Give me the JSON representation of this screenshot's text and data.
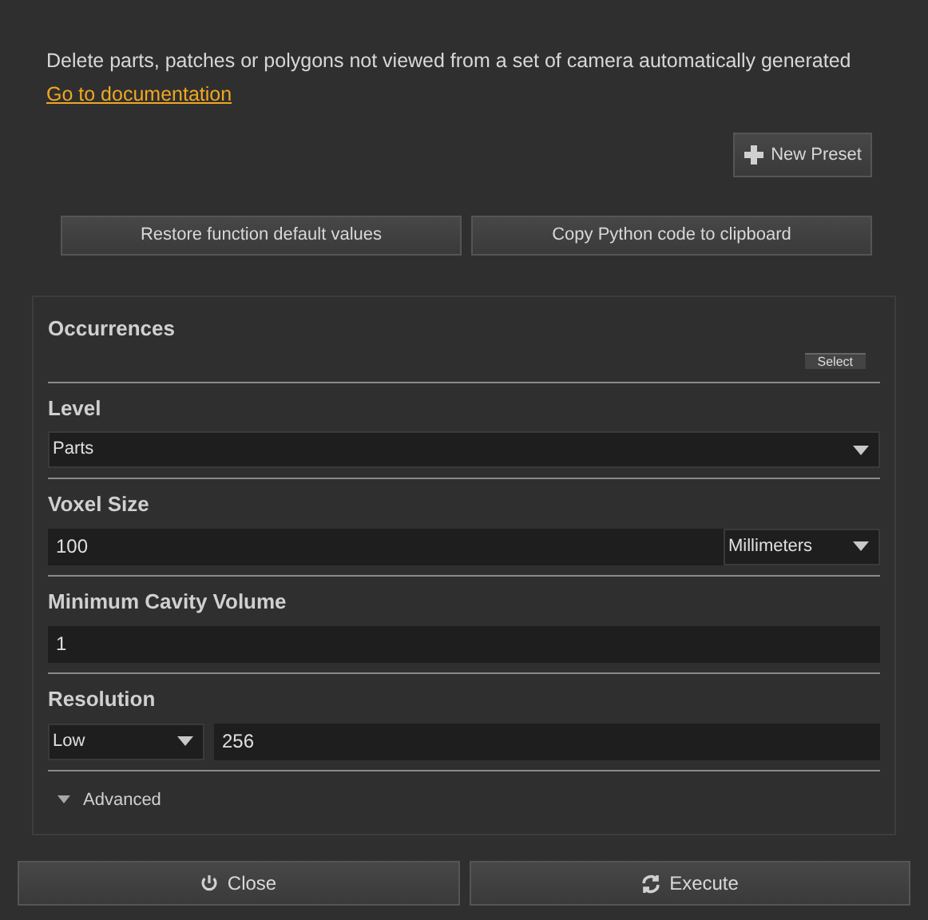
{
  "description": "Delete parts, patches or polygons not viewed from a set of camera automatically generated",
  "doc_link": "Go to documentation",
  "new_preset": "New Preset",
  "top_buttons": [
    "Restore function default values",
    "Copy Python code to clipboard"
  ],
  "occurrences": {
    "title": "Occurrences",
    "select_button": "Select"
  },
  "sections": [
    {
      "kind": "dropdown",
      "title": "Level",
      "value": "Parts"
    },
    {
      "kind": "number_with_unit",
      "title": "Voxel Size",
      "value": "100",
      "unit": "Millimeters"
    },
    {
      "kind": "number",
      "title": "Minimum Cavity Volume",
      "value": "1"
    },
    {
      "kind": "dropdown_with_number",
      "title": "Resolution",
      "option": "Low",
      "value": "256"
    }
  ],
  "advanced": {
    "label": "Advanced",
    "expanded": false
  },
  "bottom_buttons": [
    {
      "kind": "close",
      "label": "Close"
    },
    {
      "kind": "execute",
      "label": "Execute"
    }
  ]
}
